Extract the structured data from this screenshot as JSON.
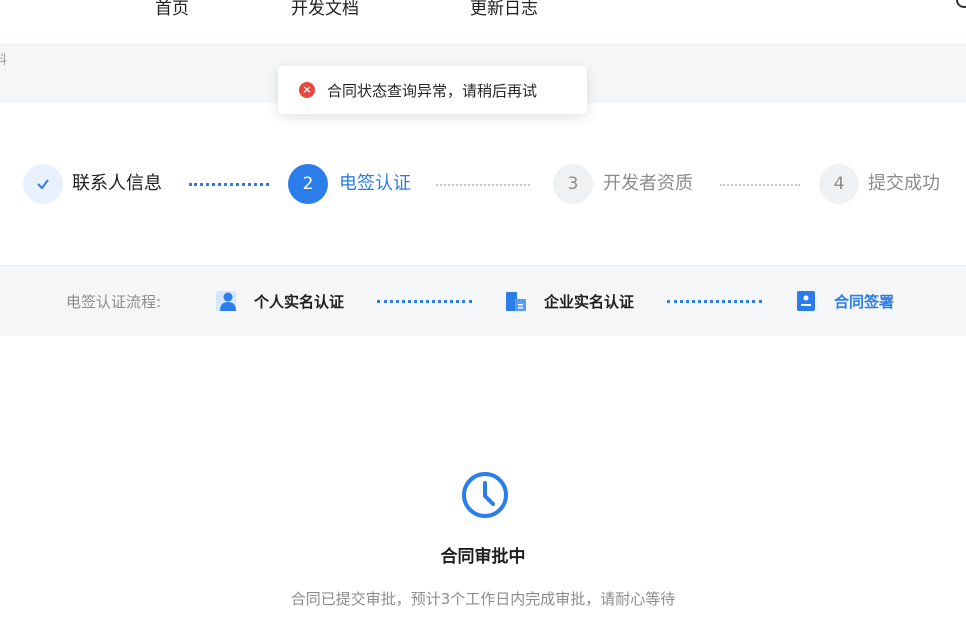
{
  "nav": {
    "items": [
      "首页",
      "开发文档",
      "更新日志"
    ]
  },
  "breadcrumb": {
    "fragment": "料"
  },
  "toast": {
    "message": "合同状态查询异常，请稍后再试",
    "icon": "error-icon",
    "color": "#e8483e"
  },
  "steps": [
    {
      "index": "✓",
      "label": "联系人信息",
      "state": "done"
    },
    {
      "index": "2",
      "label": "电签认证",
      "state": "active"
    },
    {
      "index": "3",
      "label": "开发者资质",
      "state": "wait"
    },
    {
      "index": "4",
      "label": "提交成功",
      "state": "wait"
    }
  ],
  "flow": {
    "label": "电签认证流程:",
    "items": [
      {
        "label": "个人实名认证",
        "icon": "person-icon"
      },
      {
        "label": "企业实名认证",
        "icon": "building-icon"
      },
      {
        "label": "合同签署",
        "icon": "contract-icon"
      }
    ]
  },
  "status": {
    "title": "合同审批中",
    "description": "合同已提交审批，预计3个工作日内完成审批，请耐心等待",
    "icon": "clock-icon"
  },
  "colors": {
    "accent": "#2b7de9",
    "error": "#e8483e",
    "muted": "#8c8c8c"
  }
}
